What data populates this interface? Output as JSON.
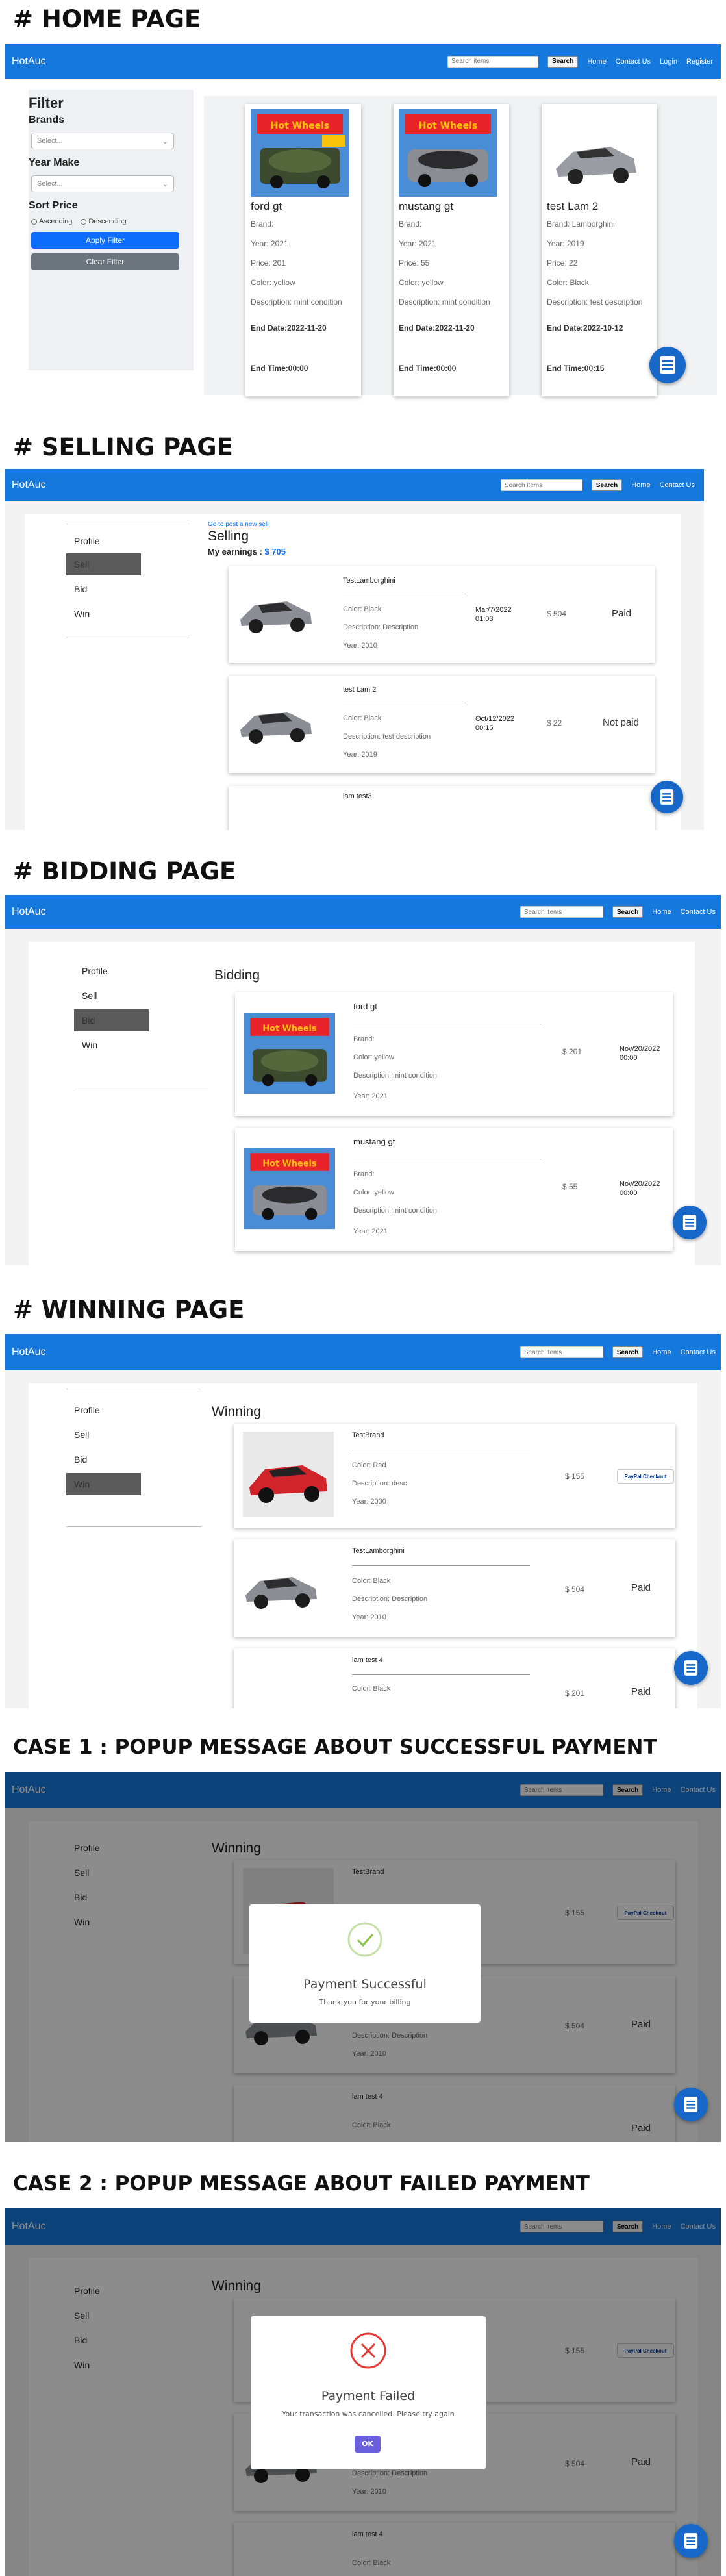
{
  "sections": {
    "home": "# HOME PAGE",
    "selling": "# SELLING PAGE",
    "bidding": "# BIDDING PAGE",
    "winning": "# WINNING PAGE",
    "case1": "CASE 1 : POPUP MESSAGE ABOUT SUCCESSFUL PAYMENT",
    "case2": "CASE 2 : POPUP MESSAGE ABOUT FAILED PAYMENT"
  },
  "nav": {
    "brand": "HotAuc",
    "search_placeholder": "Search items",
    "search_btn": "Search",
    "home": "Home",
    "contact": "Contact Us",
    "login": "Login",
    "register": "Register"
  },
  "filter": {
    "title": "Filter",
    "brands": "Brands",
    "brand_select": "Select...",
    "year_make": "Year Make",
    "year_select": "Select...",
    "sort_price": "Sort Price",
    "ascending": "Ascending",
    "descending": "Descending",
    "apply": "Apply Filter",
    "clear": "Clear Filter"
  },
  "home_cards": [
    {
      "name": "ford gt",
      "brand": "Brand:",
      "year": "Year: 2021",
      "price": "Price: 201",
      "color": "Color: yellow",
      "desc": "Description: mint condition",
      "end_date": "End Date:2022-11-20",
      "end_time": "End Time:00:00"
    },
    {
      "name": "mustang gt",
      "brand": "Brand:",
      "year": "Year: 2021",
      "price": "Price: 55",
      "color": "Color: yellow",
      "desc": "Description: mint condition",
      "end_date": "End Date:2022-11-20",
      "end_time": "End Time:00:00"
    },
    {
      "name": "test Lam 2",
      "brand": "Brand: Lamborghini",
      "year": "Year: 2019",
      "price": "Price: 22",
      "color": "Color: Black",
      "desc": "Description: test description",
      "end_date": "End Date:2022-10-12",
      "end_time": "End Time:00:15"
    }
  ],
  "side": {
    "profile": "Profile",
    "sell": "Sell",
    "bid": "Bid",
    "win": "Win"
  },
  "selling": {
    "link": "Go to post a new sell",
    "title": "Selling",
    "earnings_label": "My earnings : ",
    "earnings_value": "$ 705",
    "rows": [
      {
        "title": "TestLamborghini",
        "color": "Color: Black",
        "desc": "Description: Description",
        "year": "Year: 2010",
        "date": "Mar/7/2022 01:03",
        "price": "$ 504",
        "status": "Paid"
      },
      {
        "title": "test Lam 2",
        "color": "Color: Black",
        "desc": "Description: test description",
        "year": "Year: 2019",
        "date": "Oct/12/2022 00:15",
        "price": "$ 22",
        "status": "Not paid"
      },
      {
        "title": "lam test3"
      }
    ]
  },
  "bidding": {
    "title": "Bidding",
    "rows": [
      {
        "title": "ford gt",
        "brand": "Brand:",
        "color": "Color: yellow",
        "desc": "Description: mint condition",
        "year": "Year: 2021",
        "price": "$ 201",
        "date": "Nov/20/2022 00:00"
      },
      {
        "title": "mustang gt",
        "brand": "Brand:",
        "color": "Color: yellow",
        "desc": "Description: mint condition",
        "year": "Year: 2021",
        "price": "$ 55",
        "date": "Nov/20/2022 00:00"
      }
    ]
  },
  "winning": {
    "title": "Winning",
    "rows": [
      {
        "title": "TestBrand",
        "color": "Color: Red",
        "desc": "Description: desc",
        "year": "Year: 2000",
        "price": "$ 155",
        "paypal": "PayPal Checkout"
      },
      {
        "title": "TestLamborghini",
        "color": "Color: Black",
        "desc": "Description: Description",
        "year": "Year: 2010",
        "price": "$ 504",
        "status": "Paid"
      },
      {
        "title": "lam test 4",
        "color": "Color: Black",
        "price": "$ 201",
        "status": "Paid"
      }
    ]
  },
  "popup_success": {
    "title": "Payment Successful",
    "message": "Thank you for your billing"
  },
  "popup_failed": {
    "title": "Payment Failed",
    "message": "Your transaction was cancelled. Please try again",
    "ok": "OK"
  },
  "colors": {
    "nav": "#1478dc",
    "active_side": "#5a5a5a",
    "apply": "#0d6efd",
    "clear": "#6c757d",
    "ok": "#6a5fdc",
    "success": "#8bc34a",
    "fail": "#e53935"
  }
}
